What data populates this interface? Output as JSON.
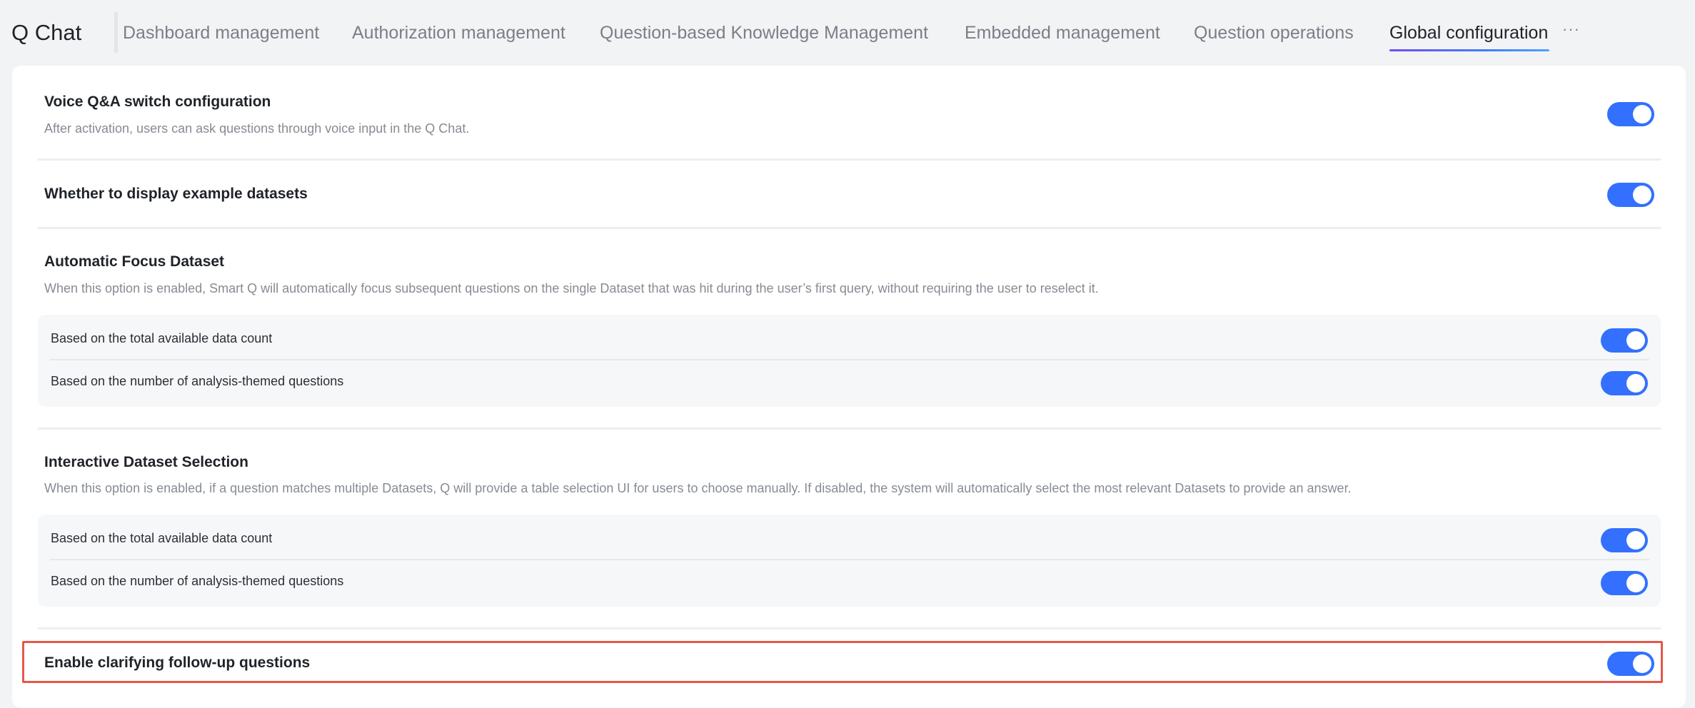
{
  "app": {
    "title": "Q Chat"
  },
  "nav": {
    "tabs": [
      {
        "label": "Dashboard management"
      },
      {
        "label": "Authorization management"
      },
      {
        "label": "Question-based Knowledge Management"
      },
      {
        "label": "Embedded management"
      },
      {
        "label": "Question operations"
      },
      {
        "label": "Global configuration",
        "active": true
      }
    ],
    "more_icon": "ellipsis-icon",
    "more_label": "···"
  },
  "settings": {
    "voice": {
      "title": "Voice Q&A switch configuration",
      "description": "After activation, users can ask questions through voice input in the Q Chat.",
      "enabled": true
    },
    "example_datasets": {
      "title": "Whether to display example datasets",
      "enabled": true
    },
    "auto_focus": {
      "title": "Automatic Focus Dataset",
      "description": "When this option is enabled, Smart Q will automatically focus subsequent questions on the single Dataset that was hit during the user’s first query, without requiring the user to reselect it.",
      "options": [
        {
          "label": "Based on the total available data count",
          "enabled": true
        },
        {
          "label": "Based on the number of analysis-themed questions",
          "enabled": true
        }
      ]
    },
    "interactive_selection": {
      "title": "Interactive Dataset Selection",
      "description": "When this option is enabled, if a question matches multiple Datasets, Q will provide a table selection UI for users to choose manually. If disabled, the system will automatically select the most relevant Datasets to provide an answer.",
      "options": [
        {
          "label": "Based on the total available data count",
          "enabled": true
        },
        {
          "label": "Based on the number of analysis-themed questions",
          "enabled": true
        }
      ]
    },
    "clarifying": {
      "title": "Enable clarifying follow-up questions",
      "enabled": true,
      "highlighted": true
    }
  },
  "colors": {
    "toggle_on": "#3370ff",
    "highlight": "#e5574a",
    "active_tab_gradient": [
      "#6e4df5",
      "#4aa3ff"
    ]
  }
}
